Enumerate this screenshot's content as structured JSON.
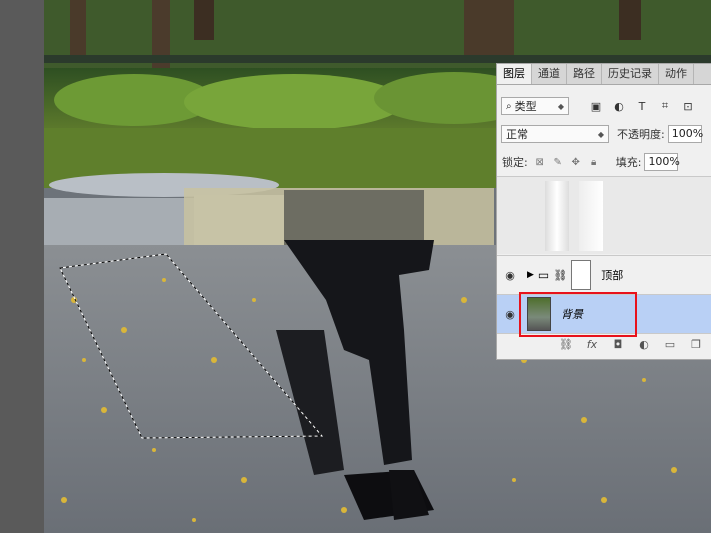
{
  "panel": {
    "tabs": [
      "图层",
      "通道",
      "路径",
      "历史记录",
      "动作"
    ],
    "filter": {
      "label": "类型",
      "search_icon": "search-icon"
    },
    "filter_icons": [
      "image-filter-icon",
      "adjustment-filter-icon",
      "type-filter-icon",
      "shape-filter-icon",
      "smart-object-filter-icon"
    ],
    "filter_glyphs": [
      "▣",
      "◐",
      "T",
      "⌗",
      "⊡"
    ],
    "blend_mode": "正常",
    "opacity_label": "不透明度:",
    "opacity_value": "100%",
    "lock_label": "锁定:",
    "fill_label": "填充:",
    "fill_value": "100%",
    "layers": [
      {
        "name": "",
        "visible": false,
        "type": "layer-mask"
      },
      {
        "name": "顶部",
        "visible": true,
        "type": "group"
      },
      {
        "name": "背景",
        "visible": true,
        "type": "background",
        "selected": true
      }
    ],
    "footer_icons": [
      "link-icon",
      "fx-icon",
      "mask-icon",
      "adjustment-icon",
      "folder-icon",
      "new-layer-icon"
    ],
    "footer_glyphs": [
      "⛓",
      "fx",
      "◘",
      "◐",
      "▭",
      "❐"
    ]
  },
  "colors": {
    "selected_layer_bg": "#b9d0f5",
    "annotation_red": "#e8121b",
    "panel_bg": "#f0f0f0"
  }
}
